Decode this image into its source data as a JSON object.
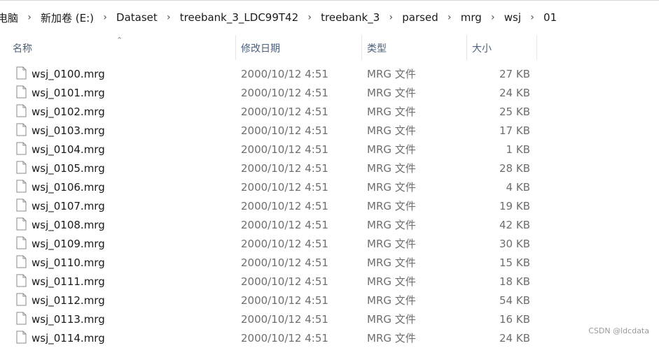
{
  "breadcrumb": [
    {
      "label": "电脑"
    },
    {
      "label": "新加卷 (E:)"
    },
    {
      "label": "Dataset"
    },
    {
      "label": "treebank_3_LDC99T42"
    },
    {
      "label": "treebank_3"
    },
    {
      "label": "parsed"
    },
    {
      "label": "mrg"
    },
    {
      "label": "wsj"
    },
    {
      "label": "01"
    }
  ],
  "columns": {
    "name": "名称",
    "date": "修改日期",
    "type": "类型",
    "size": "大小"
  },
  "files": [
    {
      "name": "wsj_0100.mrg",
      "date": "2000/10/12 4:51",
      "type": "MRG 文件",
      "size": "27 KB"
    },
    {
      "name": "wsj_0101.mrg",
      "date": "2000/10/12 4:51",
      "type": "MRG 文件",
      "size": "24 KB"
    },
    {
      "name": "wsj_0102.mrg",
      "date": "2000/10/12 4:51",
      "type": "MRG 文件",
      "size": "25 KB"
    },
    {
      "name": "wsj_0103.mrg",
      "date": "2000/10/12 4:51",
      "type": "MRG 文件",
      "size": "17 KB"
    },
    {
      "name": "wsj_0104.mrg",
      "date": "2000/10/12 4:51",
      "type": "MRG 文件",
      "size": "1 KB"
    },
    {
      "name": "wsj_0105.mrg",
      "date": "2000/10/12 4:51",
      "type": "MRG 文件",
      "size": "28 KB"
    },
    {
      "name": "wsj_0106.mrg",
      "date": "2000/10/12 4:51",
      "type": "MRG 文件",
      "size": "4 KB"
    },
    {
      "name": "wsj_0107.mrg",
      "date": "2000/10/12 4:51",
      "type": "MRG 文件",
      "size": "19 KB"
    },
    {
      "name": "wsj_0108.mrg",
      "date": "2000/10/12 4:51",
      "type": "MRG 文件",
      "size": "42 KB"
    },
    {
      "name": "wsj_0109.mrg",
      "date": "2000/10/12 4:51",
      "type": "MRG 文件",
      "size": "30 KB"
    },
    {
      "name": "wsj_0110.mrg",
      "date": "2000/10/12 4:51",
      "type": "MRG 文件",
      "size": "15 KB"
    },
    {
      "name": "wsj_0111.mrg",
      "date": "2000/10/12 4:51",
      "type": "MRG 文件",
      "size": "18 KB"
    },
    {
      "name": "wsj_0112.mrg",
      "date": "2000/10/12 4:51",
      "type": "MRG 文件",
      "size": "54 KB"
    },
    {
      "name": "wsj_0113.mrg",
      "date": "2000/10/12 4:51",
      "type": "MRG 文件",
      "size": "16 KB"
    },
    {
      "name": "wsj_0114.mrg",
      "date": "2000/10/12 4:51",
      "type": "MRG 文件",
      "size": "24 KB"
    }
  ],
  "icons": {
    "sort": "sort-up-chevron-icon",
    "file": "file-icon",
    "separator": "chevron-right-icon"
  },
  "watermark": "CSDN @ldcdata"
}
